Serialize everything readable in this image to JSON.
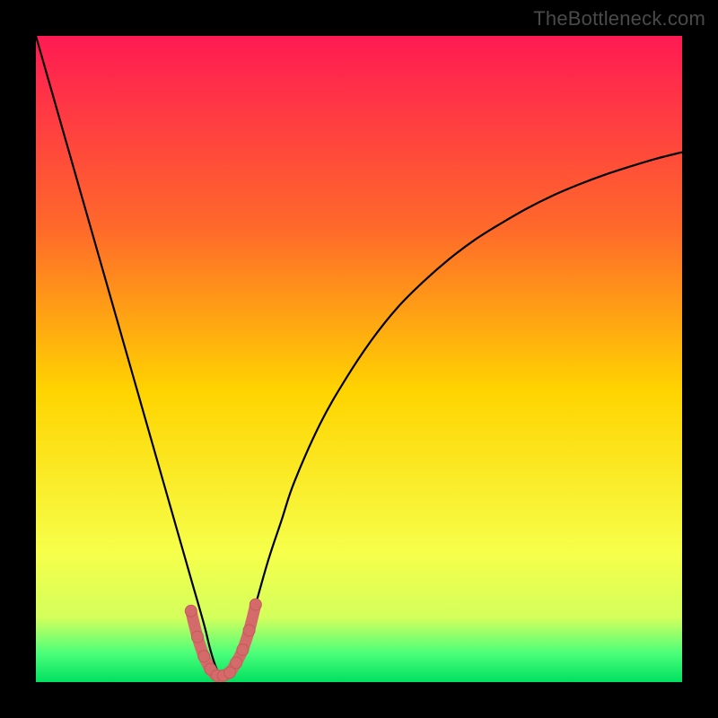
{
  "watermark": "TheBottleneck.com",
  "colors": {
    "background": "#000000",
    "curve_stroke": "#000000",
    "marker_fill": "#d46a6a",
    "marker_stroke": "#c35a5a",
    "gradient_top": "#ff1a53",
    "gradient_q1": "#ff6a2a",
    "gradient_mid": "#ffd400",
    "gradient_q3": "#f6ff4a",
    "gradient_band_top": "#d4ff5c",
    "gradient_band_bot": "#4cff7a",
    "gradient_bottom": "#00e060"
  },
  "chart_data": {
    "type": "line",
    "title": "",
    "xlabel": "",
    "ylabel": "",
    "xlim": [
      0,
      100
    ],
    "ylim": [
      0,
      100
    ],
    "x": [
      0,
      2,
      4,
      6,
      8,
      10,
      12,
      14,
      16,
      18,
      20,
      22,
      24,
      26,
      27,
      28,
      29,
      30,
      31,
      32,
      34,
      36,
      38,
      40,
      44,
      48,
      52,
      56,
      60,
      64,
      68,
      72,
      76,
      80,
      84,
      88,
      92,
      96,
      100
    ],
    "series": [
      {
        "name": "curve",
        "values": [
          100,
          93,
          86,
          79,
          72,
          65,
          58,
          51,
          44,
          37,
          30,
          23,
          16,
          9,
          5,
          2,
          1,
          1,
          2,
          5,
          12,
          19,
          25,
          31,
          40,
          47,
          53,
          58,
          62,
          65.5,
          68.5,
          71,
          73.3,
          75.3,
          77,
          78.5,
          79.8,
          81,
          82
        ]
      }
    ],
    "markers": {
      "name": "highlight-dots",
      "x": [
        24,
        25,
        26,
        27,
        28,
        29,
        30,
        31,
        32,
        33,
        34
      ],
      "y": [
        11,
        7,
        4,
        2,
        1,
        1,
        1.5,
        3,
        5,
        8,
        12
      ]
    },
    "gradient_stops": [
      {
        "offset": 0.0,
        "color": "#ff1a53"
      },
      {
        "offset": 0.3,
        "color": "#ff6a2a"
      },
      {
        "offset": 0.55,
        "color": "#ffd400"
      },
      {
        "offset": 0.8,
        "color": "#f6ff4a"
      },
      {
        "offset": 0.9,
        "color": "#d4ff5c"
      },
      {
        "offset": 0.955,
        "color": "#4cff7a"
      },
      {
        "offset": 1.0,
        "color": "#00e060"
      }
    ]
  }
}
